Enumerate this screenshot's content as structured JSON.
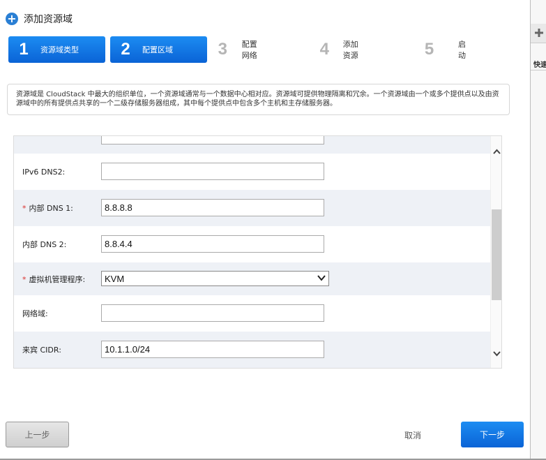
{
  "dialog": {
    "title": "添加资源域",
    "title_icon": "plus-circle-icon"
  },
  "steps": [
    {
      "number": "1",
      "label": "资源域类型",
      "state": "done"
    },
    {
      "number": "2",
      "label": "配置区域",
      "state": "active"
    },
    {
      "number": "3",
      "label": "配置网络",
      "state": "pending"
    },
    {
      "number": "4",
      "label": "添加资源",
      "state": "pending"
    },
    {
      "number": "5",
      "label": "启动",
      "state": "pending"
    }
  ],
  "info_text": "资源域是 CloudStack 中最大的组织单位，一个资源域通常与一个数据中心相对应。资源域可提供物理隔离和冗余。一个资源域由一个或多个提供点以及由资源域中的所有提供点共享的一个二级存储服务器组成，其中每个提供点中包含多个主机和主存储服务器。",
  "form": {
    "fields": [
      {
        "label": "",
        "value": "",
        "required": false
      },
      {
        "label": "IPv6 DNS2:",
        "value": "",
        "required": false
      },
      {
        "label": "内部 DNS 1:",
        "value": "8.8.8.8",
        "required": true
      },
      {
        "label": "内部 DNS 2:",
        "value": "8.8.4.4",
        "required": false
      },
      {
        "label": "虚拟机管理程序:",
        "value": "KVM",
        "required": true
      },
      {
        "label": "网络域:",
        "value": "",
        "required": false
      },
      {
        "label": "来宾 CIDR:",
        "value": "10.1.1.0/24",
        "required": false
      }
    ],
    "required_mark": "*"
  },
  "buttons": {
    "prev": "上一步",
    "cancel": "取消",
    "next": "下一步"
  },
  "side_panel": {
    "text": "快速",
    "icon": "plus-icon"
  },
  "colors": {
    "accent": "#0a63d6",
    "required": "#d9302c"
  }
}
